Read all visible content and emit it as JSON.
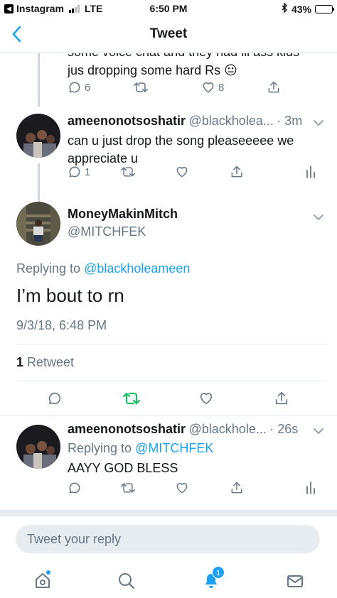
{
  "status": {
    "app": "Instagram",
    "network": "LTE",
    "time": "6:50 PM",
    "battery": "43%",
    "battery_level": 0.43
  },
  "nav": {
    "title": "Tweet"
  },
  "tweets": {
    "prev": {
      "text_line1": "some voice chat and they had lil ass kids",
      "text_line2": "jus dropping some hard Rs 😐",
      "replies": "6",
      "likes": "8"
    },
    "ameen1": {
      "name": "ameenonotsoshatir",
      "handle": "@blackholea...",
      "time": "· 3m",
      "text": "can u just drop the song pleaseeeee we appreciate u",
      "replies": "1"
    },
    "mitch": {
      "name": "MoneyMakinMitch",
      "handle": "@MITCHFEK",
      "replying_prefix": "Replying to ",
      "replying_to": "@blackholeameen",
      "text": "I’m bout to rn",
      "datetime": "9/3/18, 6:48 PM",
      "retweet_count": "1",
      "retweet_label": " Retweet"
    },
    "ameen2": {
      "name": "ameenonotsoshatir",
      "handle": "@blackhole...",
      "time": "· 26s",
      "replying_prefix": "Replying to ",
      "replying_to": "@MITCHFEK",
      "text": "AAYY GOD BLESS"
    }
  },
  "reply_box": {
    "placeholder": "Tweet your reply"
  },
  "tabbar": {
    "notifications_badge": "1"
  },
  "colors": {
    "accent": "#1da1f2",
    "retweet_green": "#17bf63",
    "muted": "#657786"
  }
}
